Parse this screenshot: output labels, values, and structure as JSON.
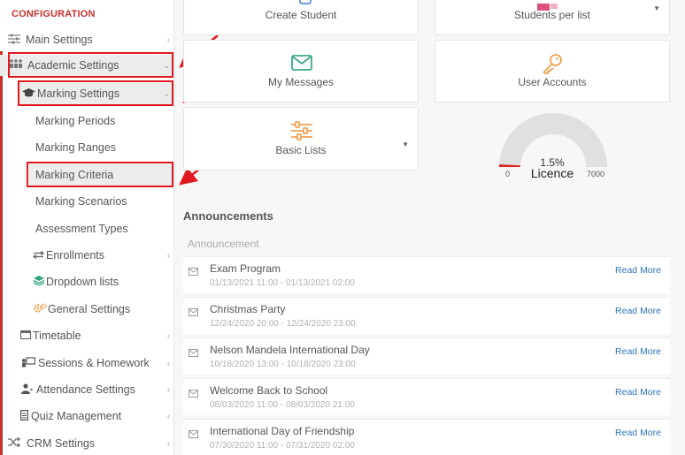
{
  "sidebar": {
    "section_title": "CONFIGURATION",
    "items": [
      {
        "label": "Main Settings",
        "icon": "sliders-icon",
        "has_chevron": true
      },
      {
        "label": "Academic Settings",
        "icon": "users-icon",
        "has_chevron": true
      },
      {
        "label": "Marking Settings",
        "icon": "graduation-cap-icon",
        "has_chevron": true
      },
      {
        "label": "Marking Periods"
      },
      {
        "label": "Marking Ranges"
      },
      {
        "label": "Marking Criteria"
      },
      {
        "label": "Marking Scenarios"
      },
      {
        "label": "Assessment Types"
      },
      {
        "label": "Enrollments",
        "icon": "arrows-exchange-icon",
        "has_chevron": true
      },
      {
        "label": "Dropdown lists",
        "icon": "layers-icon"
      },
      {
        "label": "General Settings",
        "icon": "gears-icon"
      },
      {
        "label": "Timetable",
        "icon": "calendar-icon",
        "has_chevron": true
      },
      {
        "label": "Sessions & Homework",
        "icon": "presentation-icon",
        "has_chevron": true
      },
      {
        "label": "Attendance Settings",
        "icon": "user-check-icon",
        "has_chevron": true
      },
      {
        "label": "Quiz Management",
        "icon": "clipboard-icon",
        "has_chevron": true
      },
      {
        "label": "CRM Settings",
        "icon": "shuffle-icon",
        "has_chevron": true
      }
    ]
  },
  "cards": {
    "create_student": "Create Student",
    "students_per_list": "Students per list",
    "my_messages": "My Messages",
    "user_accounts": "User Accounts",
    "basic_lists": "Basic Lists"
  },
  "gauge": {
    "percent_label": "1.5%",
    "label": "Licence",
    "min": "0",
    "max": "7000",
    "value_fraction": 0.015
  },
  "announcements": {
    "title": "Announcements",
    "subtitle": "Announcement",
    "read_more": "Read More",
    "items": [
      {
        "title": "Exam Program",
        "dates": "01/13/2021 11:00 - 01/13/2021 02:00"
      },
      {
        "title": "Christmas Party",
        "dates": "12/24/2020 20:00 - 12/24/2020 23:00"
      },
      {
        "title": "Nelson Mandela International Day",
        "dates": "10/18/2020 13:00 - 10/18/2020 23:00"
      },
      {
        "title": "Welcome Back to School",
        "dates": "08/03/2020 11:00 - 08/03/2020 21:00"
      },
      {
        "title": "International Day of Friendship",
        "dates": "07/30/2020 11:00 - 07/31/2020 02:00"
      }
    ]
  },
  "colors": {
    "accent_red": "#c9302c",
    "annotation_red": "#e0191f",
    "messages_green": "#3aaa8a",
    "orange": "#f0a050",
    "link_blue": "#2e75b6",
    "gauge_grey": "#e0e0e0"
  }
}
